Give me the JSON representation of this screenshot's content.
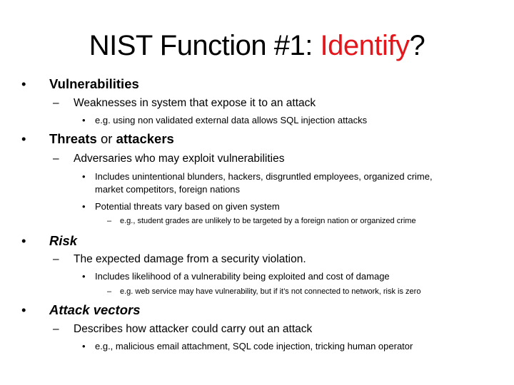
{
  "slide": {
    "title": {
      "prefix": "NIST Function #1: ",
      "highlight": "Identify",
      "suffix": "?",
      "highlight_color": "#e3161b"
    },
    "bullet_glyphs": {
      "level1": "•",
      "level2": "–",
      "level3": "•",
      "level4": "–"
    },
    "sections": [
      {
        "heading": "Vulnerabilities",
        "definition": "Weaknesses in system that expose it to an attack",
        "details": [
          "e.g. using non validated external data allows SQL injection attacks"
        ]
      },
      {
        "heading_part1": "Threats",
        "heading_connector": " or ",
        "heading_part2": "attackers",
        "definition": "Adversaries who may exploit vulnerabilities",
        "details": [
          "Includes unintentional blunders, hackers, disgruntled employees, organized crime,",
          "market competitors, foreign nations",
          "Potential threats vary based on given system"
        ],
        "example": "e.g., student grades are unlikely to be targeted by a foreign nation or organized crime"
      },
      {
        "heading": "Risk",
        "definition": "The expected damage from a security violation.",
        "details": [
          "Includes likelihood of a vulnerability being exploited and cost of damage"
        ],
        "example": "e.g. web service may have vulnerability, but if it’s not connected to network, risk is zero"
      },
      {
        "heading": "Attack vectors",
        "definition": "Describes how attacker could carry out an attack",
        "details": [
          "e.g., malicious email attachment, SQL code injection, tricking human operator"
        ]
      }
    ]
  }
}
